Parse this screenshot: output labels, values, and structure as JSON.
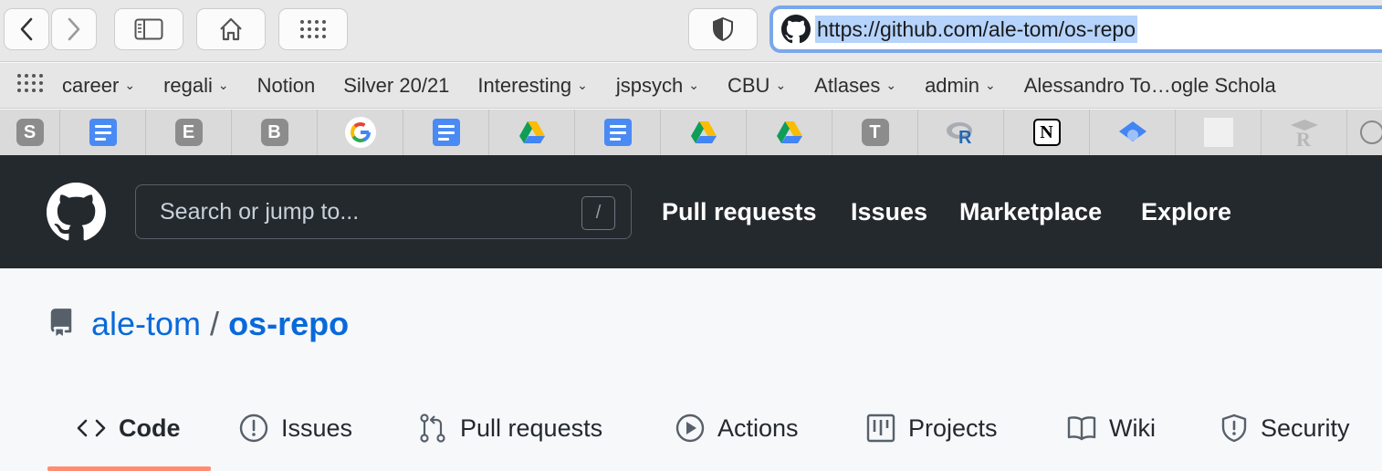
{
  "browser": {
    "url": "https://github.com/ale-tom/os-repo"
  },
  "bookmarks": {
    "items": [
      {
        "label": "career",
        "folder": true
      },
      {
        "label": "regali",
        "folder": true
      },
      {
        "label": "Notion",
        "folder": false
      },
      {
        "label": "Silver 20/21",
        "folder": false
      },
      {
        "label": "Interesting",
        "folder": true
      },
      {
        "label": "jspsych",
        "folder": true
      },
      {
        "label": "CBU",
        "folder": true
      },
      {
        "label": "Atlases",
        "folder": true
      },
      {
        "label": "admin",
        "folder": true
      },
      {
        "label": "Alessandro To…ogle Schola",
        "folder": false
      }
    ]
  },
  "favorites": {
    "letters": [
      "S",
      "E",
      "B",
      "T"
    ],
    "notion_letter": "N",
    "r_letter": "R"
  },
  "github_header": {
    "search_placeholder": "Search or jump to...",
    "search_shortcut": "/",
    "nav": [
      "Pull requests",
      "Issues",
      "Marketplace",
      "Explore"
    ]
  },
  "repo": {
    "owner": "ale-tom",
    "separator": "/",
    "name": "os-repo"
  },
  "repo_tabs": [
    {
      "label": "Code",
      "icon": "code-icon",
      "active": true
    },
    {
      "label": "Issues",
      "icon": "issue-icon",
      "active": false
    },
    {
      "label": "Pull requests",
      "icon": "pull-request-icon",
      "active": false
    },
    {
      "label": "Actions",
      "icon": "play-icon",
      "active": false
    },
    {
      "label": "Projects",
      "icon": "project-icon",
      "active": false
    },
    {
      "label": "Wiki",
      "icon": "book-icon",
      "active": false
    },
    {
      "label": "Security",
      "icon": "shield-icon",
      "active": false
    }
  ],
  "colors": {
    "header_bg": "#24292e",
    "link": "#0969da",
    "active_underline": "#fd8c73",
    "url_highlight": "#b5d3fb"
  }
}
